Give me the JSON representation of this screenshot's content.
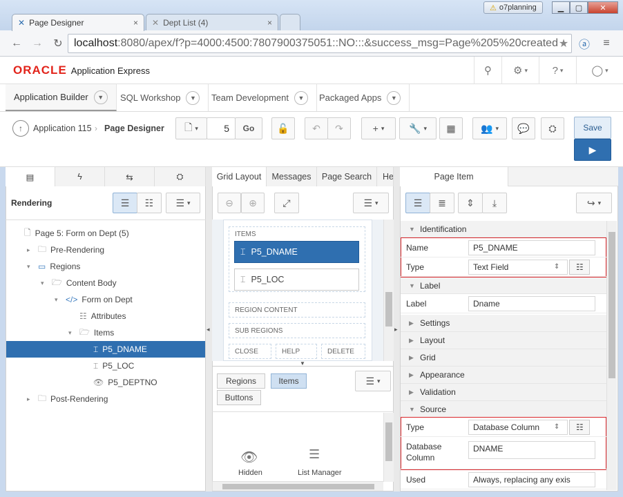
{
  "browser": {
    "tabs": [
      {
        "title": "Page Designer",
        "close": "×"
      },
      {
        "title": "Dept List (4)",
        "close": "×"
      }
    ],
    "user": "o7planning",
    "url_host": "localhost",
    "url_path": ":8080/apex/f?p=4000:4500:7807900375051::NO:::&success_msg=Page%205%20created"
  },
  "apex": {
    "brand": "ORACLE",
    "product": "Application Express",
    "menu": [
      "Application Builder",
      "SQL Workshop",
      "Team Development",
      "Packaged Apps"
    ]
  },
  "designer": {
    "breadcrumb_app": "Application 115",
    "breadcrumb_page": "Page Designer",
    "page_number": "5",
    "go_label": "Go",
    "save_label": "Save"
  },
  "left_panel": {
    "title": "Rendering",
    "tree": [
      {
        "label": "Page 5: Form on Dept (5)",
        "indent": 0,
        "toggle": "",
        "icon": "page-icon"
      },
      {
        "label": "Pre-Rendering",
        "indent": 1,
        "toggle": "▸",
        "icon": "folder-icon"
      },
      {
        "label": "Regions",
        "indent": 1,
        "toggle": "▾",
        "icon": "region-icon"
      },
      {
        "label": "Content Body",
        "indent": 2,
        "toggle": "▾",
        "icon": "folder-open-icon"
      },
      {
        "label": "Form on Dept",
        "indent": 3,
        "toggle": "▾",
        "icon": "code-icon"
      },
      {
        "label": "Attributes",
        "indent": 4,
        "toggle": "",
        "icon": "list-icon"
      },
      {
        "label": "Items",
        "indent": 4,
        "toggle": "▾",
        "icon": "folder-open-icon"
      },
      {
        "label": "P5_DNAME",
        "indent": 5,
        "toggle": "",
        "icon": "textfield-icon",
        "selected": true
      },
      {
        "label": "P5_LOC",
        "indent": 5,
        "toggle": "",
        "icon": "textfield-icon"
      },
      {
        "label": "P5_DEPTNO",
        "indent": 5,
        "toggle": "",
        "icon": "hidden-icon"
      },
      {
        "label": "Post-Rendering",
        "indent": 1,
        "toggle": "▸",
        "icon": "folder-icon"
      }
    ]
  },
  "center_panel": {
    "tabs": [
      "Grid Layout",
      "Messages",
      "Page Search",
      "He"
    ],
    "items_label": "ITEMS",
    "item_dname": "P5_DNAME",
    "item_loc": "P5_LOC",
    "region_content": "REGION CONTENT",
    "sub_regions": "SUB REGIONS",
    "close": "CLOSE",
    "help": "HELP",
    "delete": "DELETE",
    "gallery_tabs": [
      "Regions",
      "Items",
      "Buttons"
    ],
    "hidden_label": "Hidden",
    "list_manager_label": "List Manager"
  },
  "right_panel": {
    "tab": "Page Item",
    "identification": {
      "title": "Identification",
      "name_label": "Name",
      "name_value": "P5_DNAME",
      "type_label": "Type",
      "type_value": "Text Field"
    },
    "label": {
      "title": "Label",
      "label_label": "Label",
      "label_value": "Dname"
    },
    "collapsed": [
      "Settings",
      "Layout",
      "Grid",
      "Appearance",
      "Validation"
    ],
    "source": {
      "title": "Source",
      "type_label": "Type",
      "type_value": "Database Column",
      "dbcol_label": "Database Column",
      "dbcol_value": "DNAME",
      "used_label": "Used",
      "used_value": "Always, replacing any exis"
    }
  }
}
